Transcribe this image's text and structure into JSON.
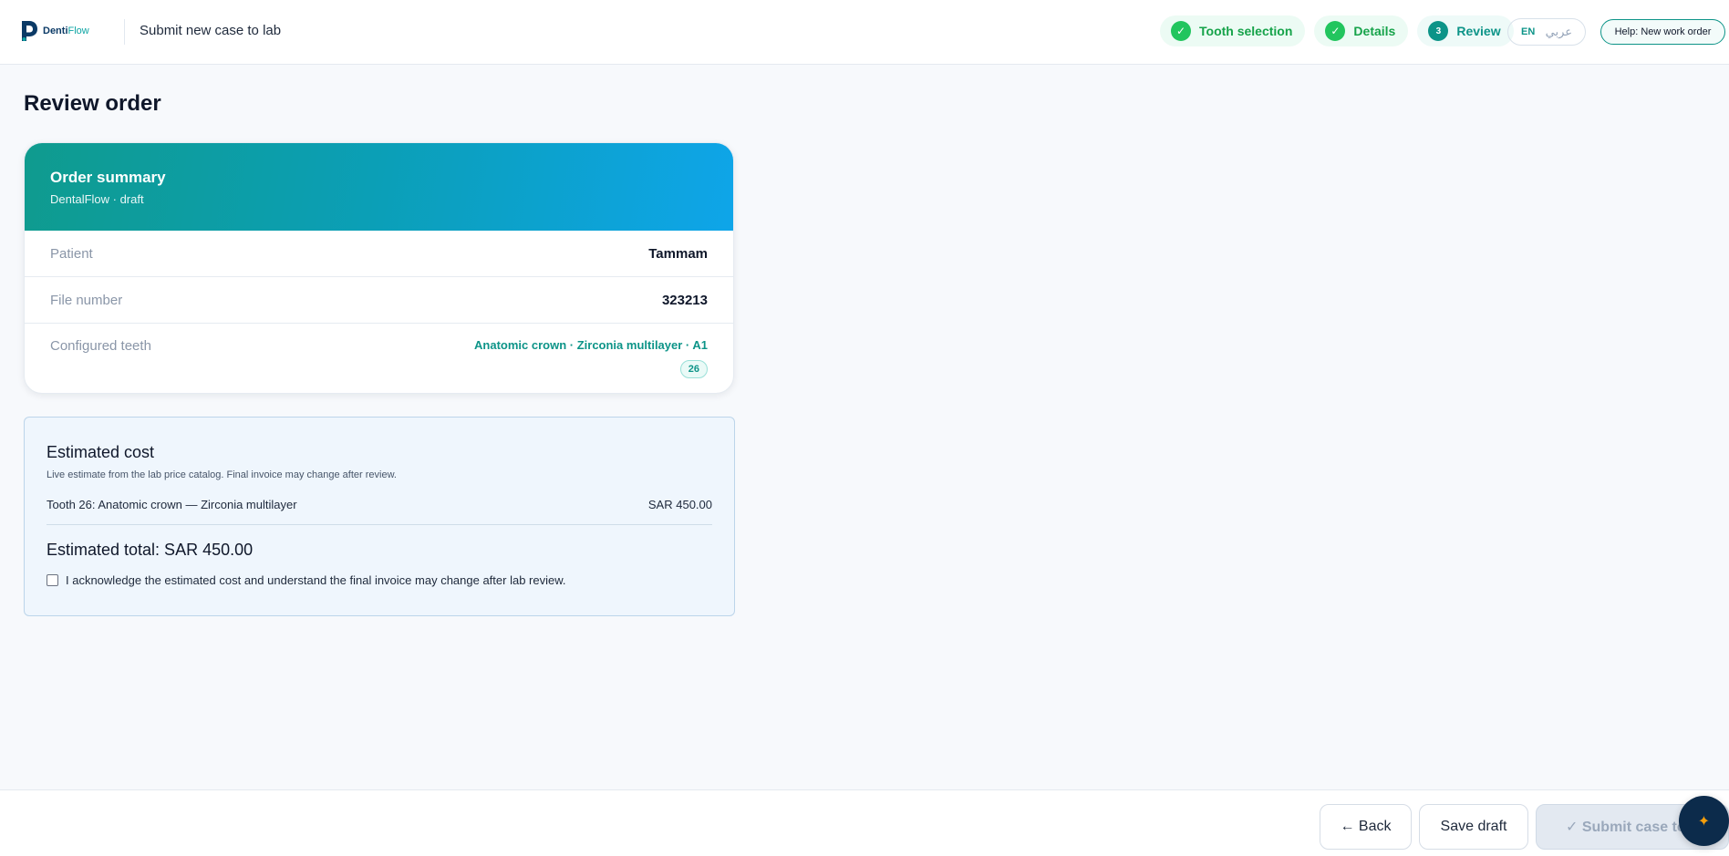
{
  "app": {
    "logo_prefix": "Denti",
    "logo_suffix": "Flow",
    "heading": "Submit new case to lab"
  },
  "stepper": {
    "steps": [
      {
        "label": "Tooth selection",
        "marker": "✓",
        "state": "done"
      },
      {
        "label": "Details",
        "marker": "✓",
        "state": "done"
      },
      {
        "label": "Review",
        "marker": "3",
        "state": "active"
      }
    ]
  },
  "language": {
    "en": "EN",
    "ar": "عربي"
  },
  "help": {
    "label": "Help: New work order"
  },
  "review": {
    "title": "Review order"
  },
  "summary": {
    "title": "Order summary",
    "subtitle": "DentalFlow · draft",
    "rows": [
      {
        "label": "Patient",
        "value": "Tammam"
      },
      {
        "label": "File number",
        "value": "323213"
      }
    ],
    "teeth": {
      "label": "Configured teeth",
      "description": "Anatomic crown · Zirconia multilayer · A1",
      "tooth": "26"
    }
  },
  "cost": {
    "title": "Estimated cost",
    "subtitle": "Live estimate from the lab price catalog. Final invoice may change after review.",
    "line_item": {
      "label": "Tooth 26: Anatomic crown — Zirconia multilayer",
      "amount": "SAR 450.00"
    },
    "total": "Estimated total: SAR 450.00",
    "acknowledge": "I acknowledge the estimated cost and understand the final invoice may change after lab review.",
    "acknowledged": false
  },
  "footer": {
    "back": "← Back",
    "save_draft": "Save draft",
    "submit": "✓ Submit case to lab"
  },
  "fab": {
    "icon": "sparkle-icon",
    "glyph": "✦"
  },
  "colors": {
    "accent": "#0d9488",
    "done": "#22c55e",
    "gradient_start": "#0f9b8e",
    "gradient_end": "#0ea5e9"
  }
}
